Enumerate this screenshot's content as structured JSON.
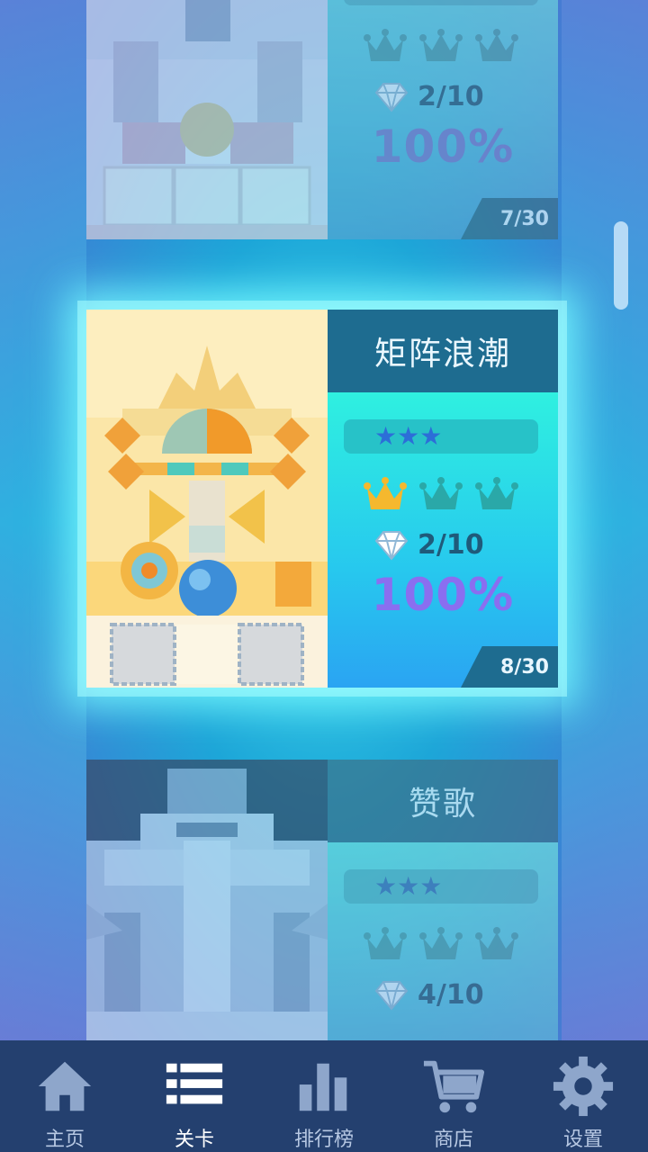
{
  "levels": [
    {
      "title": "",
      "difficulty_stars": "★★★",
      "crowns_earned": 0,
      "gems": "2/10",
      "percent": "100%",
      "level_number": "7/30",
      "state": "dimmed"
    },
    {
      "title": "矩阵浪潮",
      "difficulty_stars": "★★★",
      "crowns_earned": 1,
      "gems": "2/10",
      "percent": "100%",
      "level_number": "8/30",
      "state": "selected"
    },
    {
      "title": "赞歌",
      "difficulty_stars": "★★★",
      "crowns_earned": 0,
      "gems": "4/10",
      "percent": "",
      "level_number": "",
      "state": "dimmed"
    }
  ],
  "nav": {
    "items": [
      {
        "label": "主页",
        "icon": "home-icon",
        "active": false
      },
      {
        "label": "关卡",
        "icon": "list-icon",
        "active": true
      },
      {
        "label": "排行榜",
        "icon": "bar-chart-icon",
        "active": false
      },
      {
        "label": "商店",
        "icon": "cart-icon",
        "active": false
      },
      {
        "label": "设置",
        "icon": "gear-icon",
        "active": false
      }
    ]
  },
  "colors": {
    "nav_bg": "#24406f",
    "title_bar": "#1e6c90",
    "crown_gold": "#f5b82e",
    "crown_empty": "#2aa8a8",
    "percent": "#8a6ef0"
  }
}
